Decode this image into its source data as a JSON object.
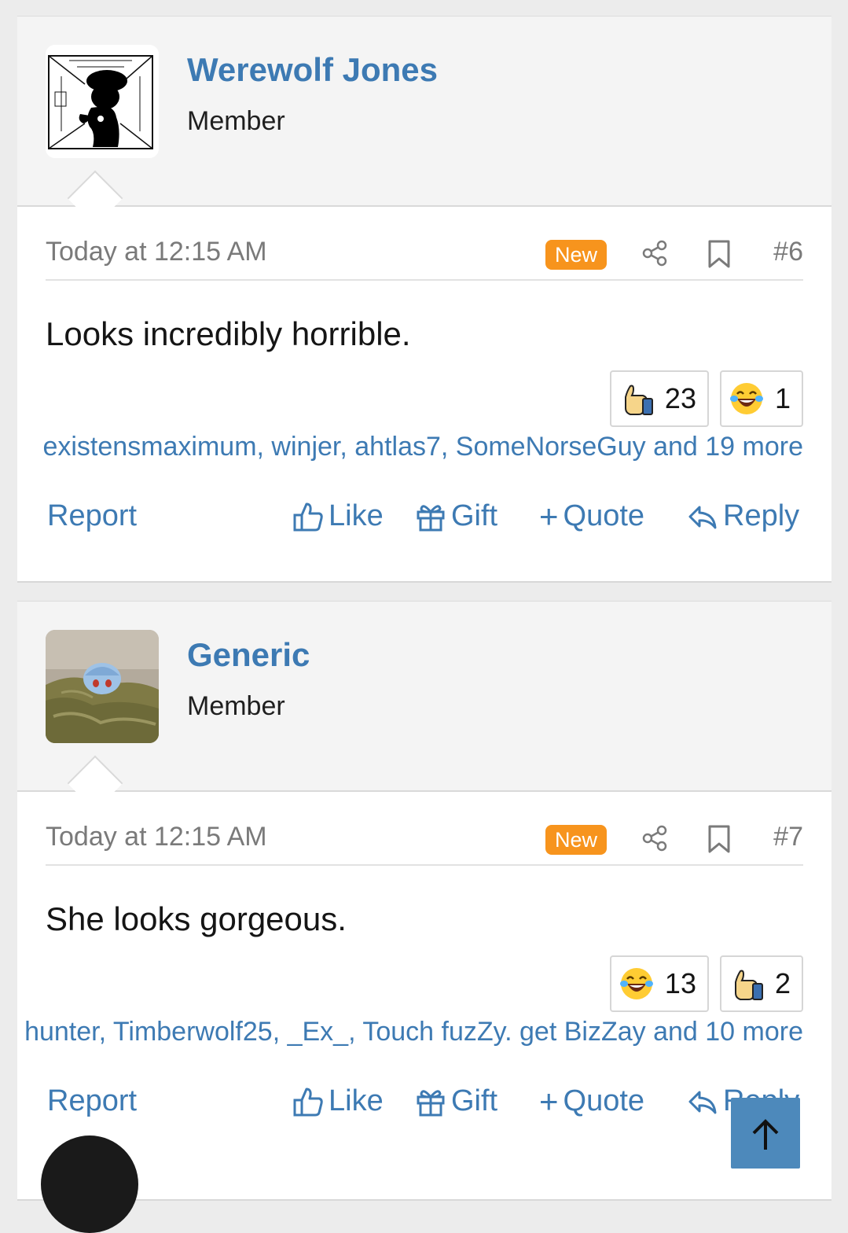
{
  "posts": [
    {
      "username": "Werewolf Jones",
      "role": "Member",
      "time": "Today at 12:15 AM",
      "badge": "New",
      "number": "#6",
      "text": "Looks incredibly horrible.",
      "reactions": [
        {
          "icon": "thumbs-up-icon",
          "count": "23"
        },
        {
          "icon": "laughing-emoji-icon",
          "count": "1"
        }
      ],
      "reactors": "existensmaximum, winjer, ahtlas7, SomeNorseGuy and 19 more"
    },
    {
      "username": "Generic",
      "role": "Member",
      "time": "Today at 12:15 AM",
      "badge": "New",
      "number": "#7",
      "text": "She looks gorgeous.",
      "reactions": [
        {
          "icon": "laughing-emoji-icon",
          "count": "13"
        },
        {
          "icon": "thumbs-up-icon",
          "count": "2"
        }
      ],
      "reactors": "hunter, Timberwolf25, _Ex_, Touch fuzZy. get BizZay and 10 more"
    }
  ],
  "actions": {
    "report": "Report",
    "like": "Like",
    "gift": "Gift",
    "quote": "Quote",
    "reply": "Reply"
  },
  "colors": {
    "link": "#3d7ab3",
    "badge": "#f7941d",
    "scroll_button": "#4d89bb"
  }
}
